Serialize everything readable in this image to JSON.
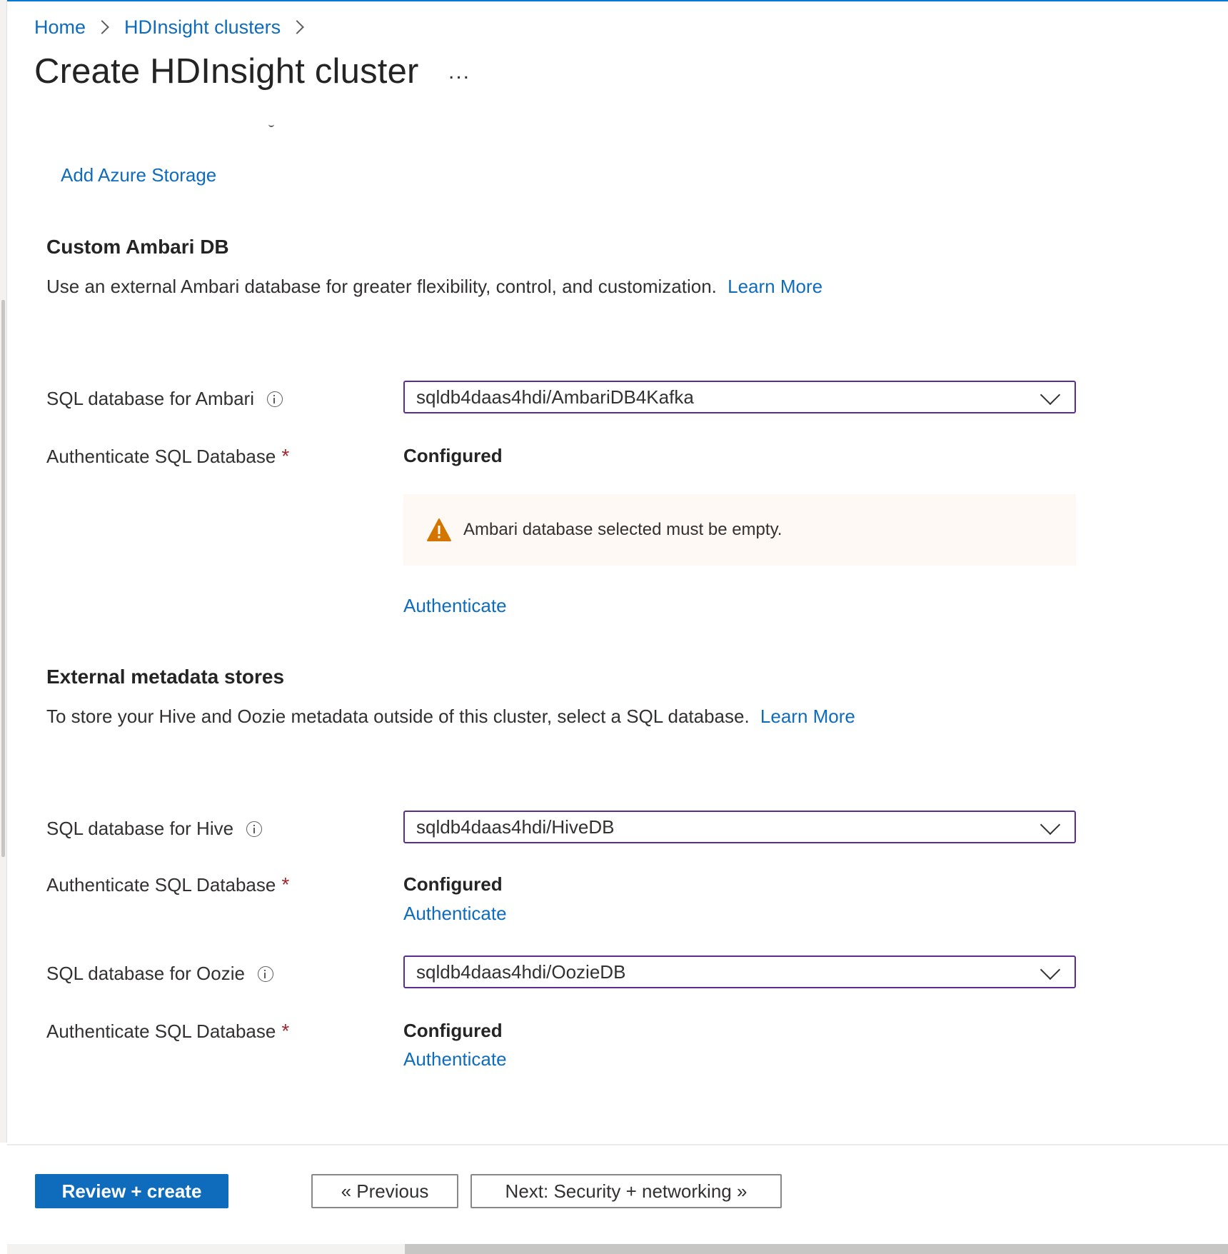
{
  "breadcrumb": {
    "home": "Home",
    "clusters": "HDInsight clusters"
  },
  "title": "Create HDInsight cluster",
  "more_label": "...",
  "storage": {
    "add_link": "Add Azure Storage"
  },
  "ambari": {
    "title": "Custom Ambari DB",
    "description": "Use an external Ambari database for greater flexibility, control, and customization.",
    "learn_more": "Learn More",
    "sql_label": "SQL database for Ambari",
    "sql_value": "sqldb4daas4hdi/AmbariDB4Kafka",
    "auth_label": "Authenticate SQL Database",
    "auth_status": "Configured",
    "warning": "Ambari database selected must be empty.",
    "auth_link": "Authenticate"
  },
  "metadata": {
    "title": "External metadata stores",
    "description": "To store your Hive and Oozie metadata outside of this cluster, select a SQL database.",
    "learn_more": "Learn More",
    "hive": {
      "sql_label": "SQL database for Hive",
      "sql_value": "sqldb4daas4hdi/HiveDB",
      "auth_label": "Authenticate SQL Database",
      "auth_status": "Configured",
      "auth_link": "Authenticate"
    },
    "oozie": {
      "sql_label": "SQL database for Oozie",
      "sql_value": "sqldb4daas4hdi/OozieDB",
      "auth_label": "Authenticate SQL Database",
      "auth_status": "Configured",
      "auth_link": "Authenticate"
    }
  },
  "required_mark": "*",
  "footer": {
    "review_create": "Review + create",
    "previous": "« Previous",
    "next": "Next: Security + networking »"
  },
  "colors": {
    "accent": "#0f6cbd",
    "dropdown_border": "#5c2d91",
    "warning_bg": "#fff9f5",
    "warning_icon": "#d47500",
    "required": "#a4262c"
  }
}
